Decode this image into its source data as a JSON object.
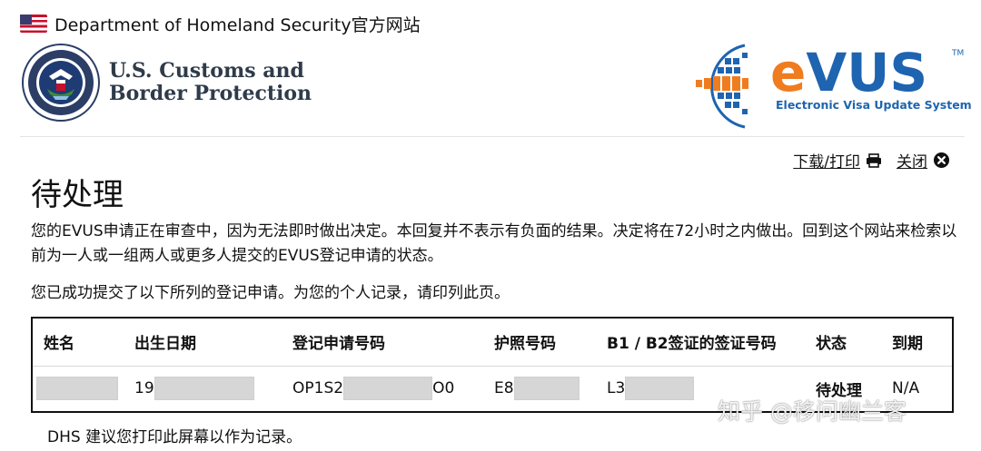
{
  "gov_banner": {
    "text": "Department of Homeland Security官方网站",
    "flag_icon": "us-flag-icon"
  },
  "header": {
    "agency_line1": "U.S. Customs and",
    "agency_line2": "Border Protection",
    "seal_text_top": "U.S. DEPARTMENT OF",
    "seal_text_bottom": "HOMELAND SECURITY",
    "evus_e": "e",
    "evus_vus": "VUS",
    "evus_tm": "TM",
    "evus_subtitle": "Electronic Visa Update System",
    "colors": {
      "evus_orange": "#f07c20",
      "evus_blue": "#1e64b0"
    }
  },
  "actions": {
    "print_label": "下载/打印",
    "close_label": "关闭",
    "print_icon": "printer-icon",
    "close_icon": "close-circle-icon"
  },
  "page_title": "待处理",
  "messages": {
    "line1": "您的EVUS申请正在审查中，因为无法即时做出决定。本回复并不表示有负面的结果。决定将在72小时之内做出。回到这个网站来检索以前为一人或一组两人或更多人提交的EVUS登记申请的状态。",
    "line2": "您已成功提交了以下所列的登记申请。为您的个人记录，请印列此页。"
  },
  "table": {
    "headers": [
      "姓名",
      "出生日期",
      "登记申请号码",
      "护照号码",
      "B1 / B2签证的签证号码",
      "状态",
      "到期"
    ],
    "row": {
      "name_visible": "",
      "dob_prefix": "19",
      "app_prefix": "OP1S2",
      "app_suffix": "O0",
      "passport_prefix": "E8",
      "visa_prefix": "L3",
      "status": "待处理",
      "expiry": "N/A"
    }
  },
  "watermark": "知乎 @移问幽兰客",
  "footer_note": "DHS 建议您打印此屏幕以作为记录。"
}
